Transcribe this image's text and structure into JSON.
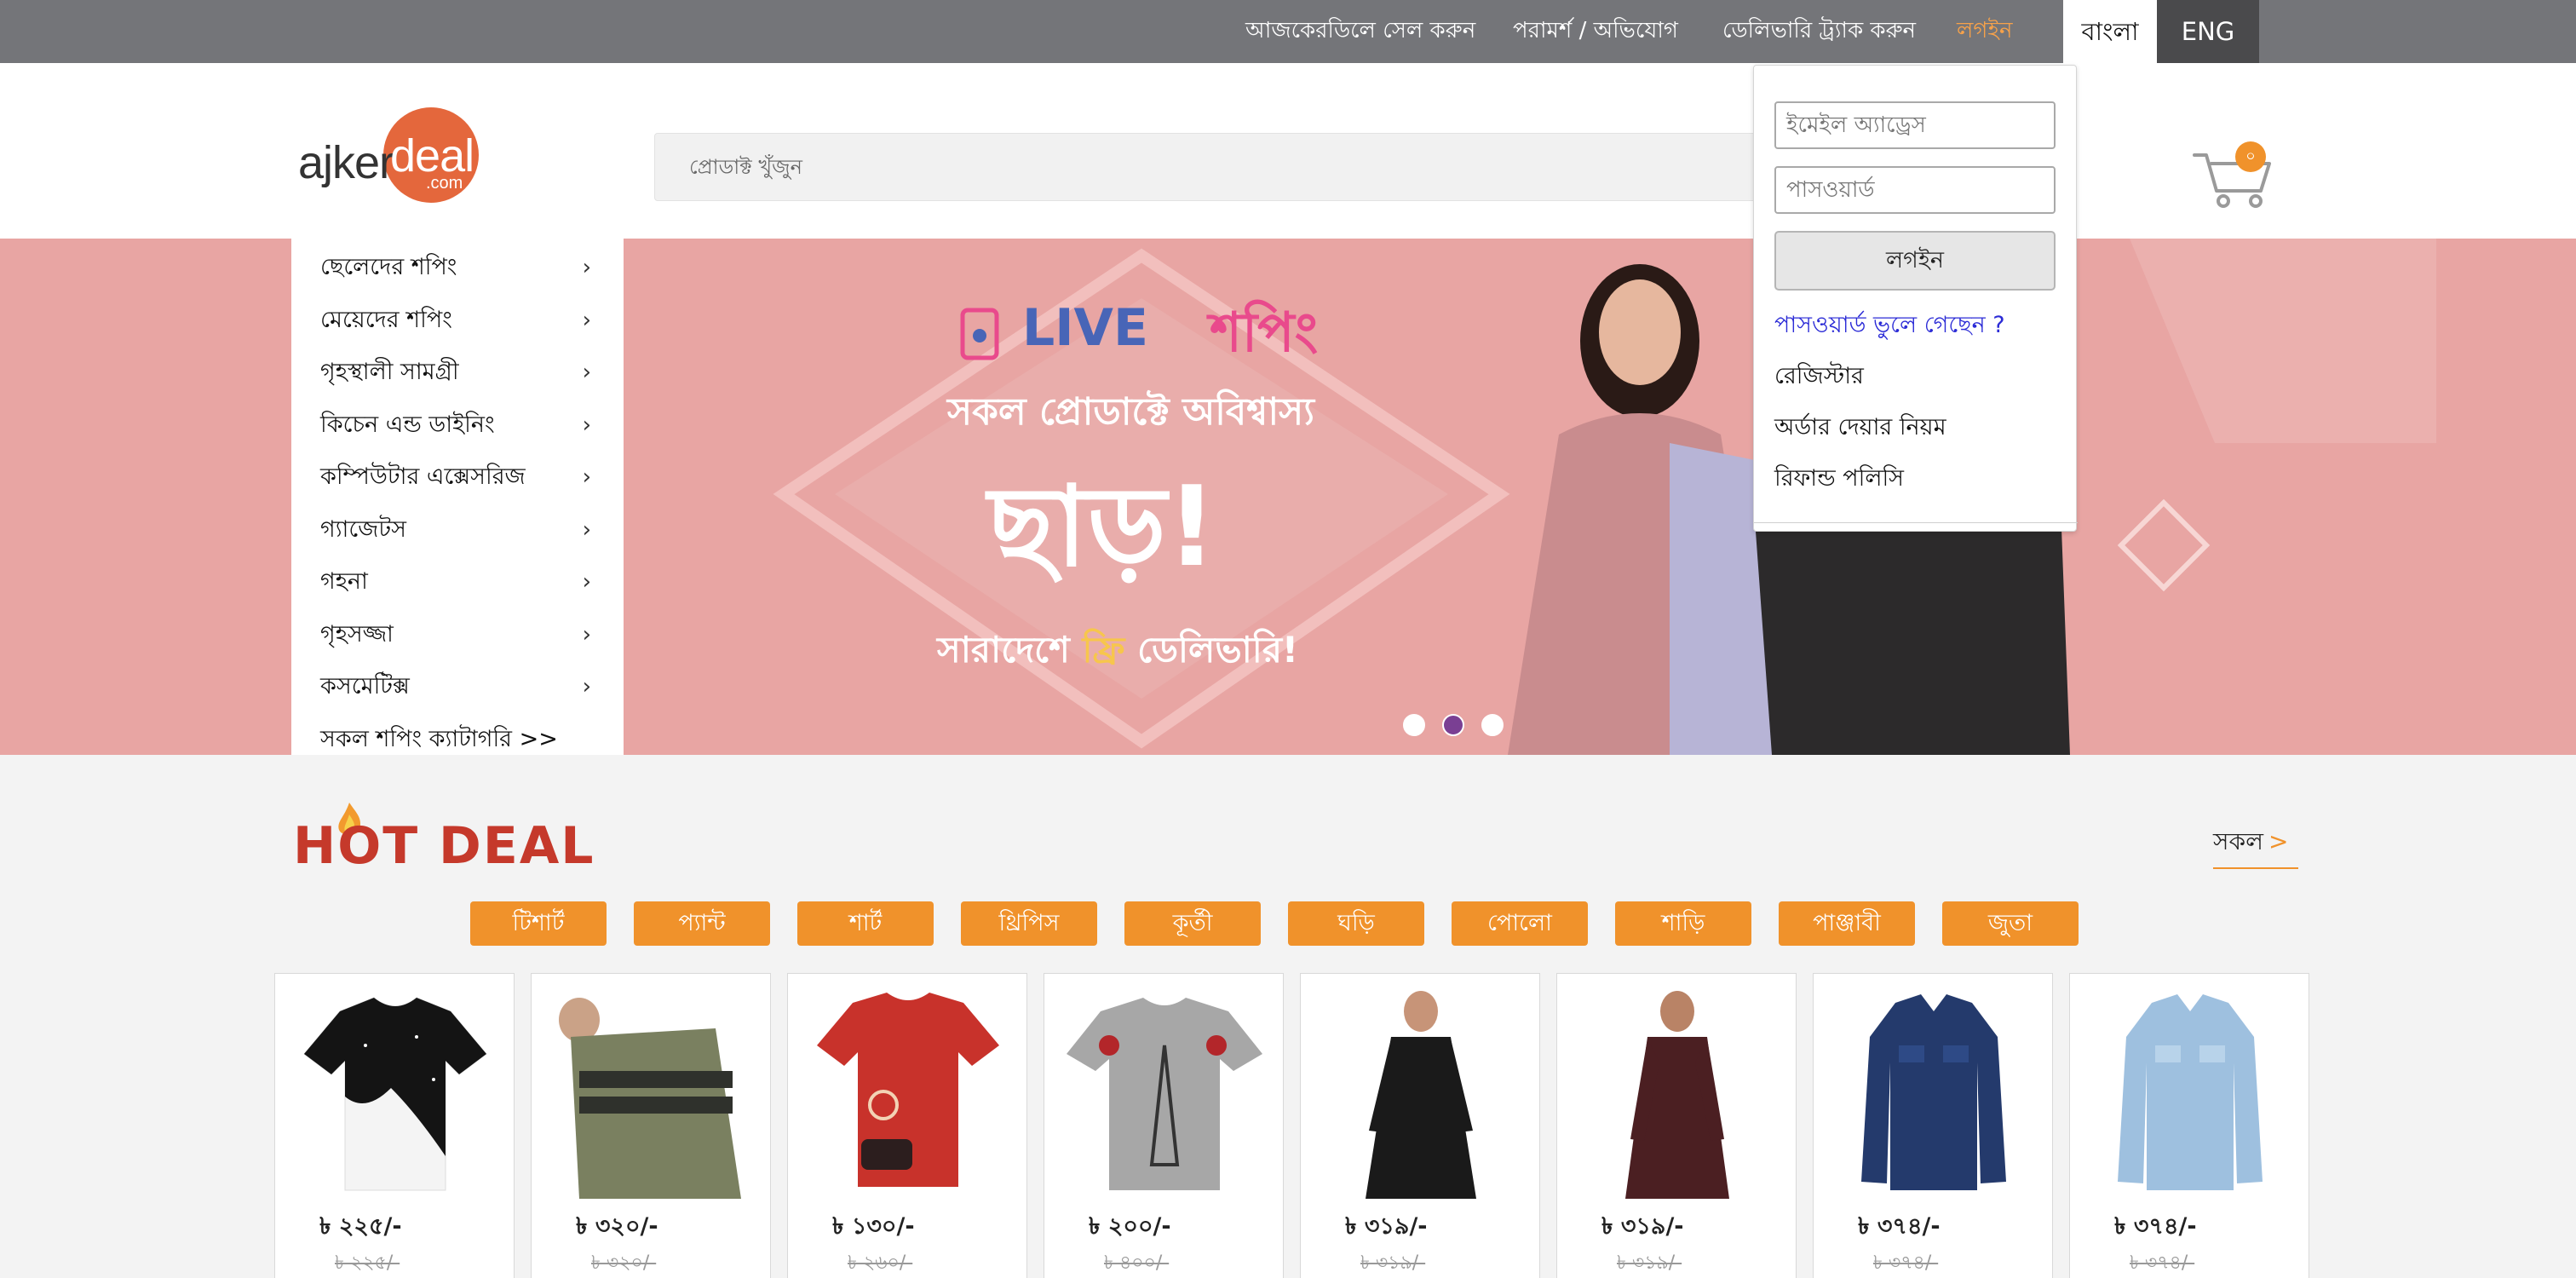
{
  "topbar": {
    "links": [
      "আজকেরডিলে সেল করুন",
      "পরামর্শ / অভিযোগ",
      "ডেলিভারি ট্র্যাক করুন"
    ],
    "login_label": "লগইন",
    "lang_bangla": "বাংলা",
    "lang_english": "ENG"
  },
  "header": {
    "logo_ajker": "ajker",
    "logo_deal": "deal",
    "logo_com": ".com",
    "search_placeholder": "প্রোডাক্ট খুঁজুন",
    "cart_count": "০"
  },
  "categories": [
    {
      "label": "ছেলেদের শপিং"
    },
    {
      "label": "মেয়েদের শপিং"
    },
    {
      "label": "গৃহস্থালী সামগ্রী"
    },
    {
      "label": "কিচেন এন্ড ডাইনিং"
    },
    {
      "label": "কম্পিউটার এক্সেসরিজ"
    },
    {
      "label": "গ্যাজেটস"
    },
    {
      "label": "গহনা"
    },
    {
      "label": "গৃহসজ্জা"
    },
    {
      "label": "কসমেটিক্স"
    },
    {
      "label": "সকল শপিং ক্যাটাগরি >>"
    }
  ],
  "banner": {
    "live": "LIVE",
    "shopping": "শপিং",
    "line1": "সকল প্রোডাক্টে অবিশ্বাস্য",
    "line2": "ছাড়!",
    "line3a": "সারাদেশে",
    "line3b": "ফ্রি",
    "line3c": "ডেলিভারি!",
    "slides": 3,
    "active_slide": 2
  },
  "login_dropdown": {
    "email_placeholder": "ইমেইল অ্যাড্রেস",
    "password_placeholder": "পাসওয়ার্ড",
    "login_button": "লগইন",
    "forgot_password": "পাসওয়ার্ড ভুলে গেছেন ?",
    "register": "রেজিস্টার",
    "order_rules": "অর্ডার দেয়ার নিয়ম",
    "refund_policy": "রিফান্ড পলিসি"
  },
  "hot_deal": {
    "title": "HOT DEAL",
    "see_all": "সকল",
    "see_all_arrow": ">",
    "chips": [
      "টিশার্ট",
      "প্যান্ট",
      "শার্ট",
      "থ্রিপিস",
      "কূর্তী",
      "ঘড়ি",
      "পোলো",
      "শাড়ি",
      "পাঞ্জাবী",
      "জুতা"
    ]
  },
  "products": [
    {
      "name": "black-white-tshirt",
      "price": "৳ ২২৫/-",
      "old_price": "৳ ২২৫/-"
    },
    {
      "name": "olive-striped-tshirt",
      "price": "৳ ৩২০/-",
      "old_price": "৳ ৩২০/-"
    },
    {
      "name": "red-print-tshirt",
      "price": "৳ ১৩০/-",
      "old_price": "৳ ২৬০/-"
    },
    {
      "name": "grey-paris-tshirt",
      "price": "৳ ২০০/-",
      "old_price": "৳ ৪০০/-"
    },
    {
      "name": "black-shirt",
      "price": "৳ ৩১৯/-",
      "old_price": "৳ ৩১৯/-"
    },
    {
      "name": "maroon-shirt",
      "price": "৳ ৩১৯/-",
      "old_price": "৳ ৩১৯/-"
    },
    {
      "name": "navy-denim-shirt",
      "price": "৳ ৩৭৪/-",
      "old_price": "৳ ৩৭৪/-"
    },
    {
      "name": "light-denim-shirt",
      "price": "৳ ৩৭৪/-",
      "old_price": "৳ ৩৭৪/-"
    }
  ],
  "colors": {
    "topbar": "#747579",
    "accent_orange": "#f0922b",
    "hero_pink": "#e8a5a3",
    "hot_red": "#c5392b",
    "link_blue": "#2b2bd6"
  }
}
